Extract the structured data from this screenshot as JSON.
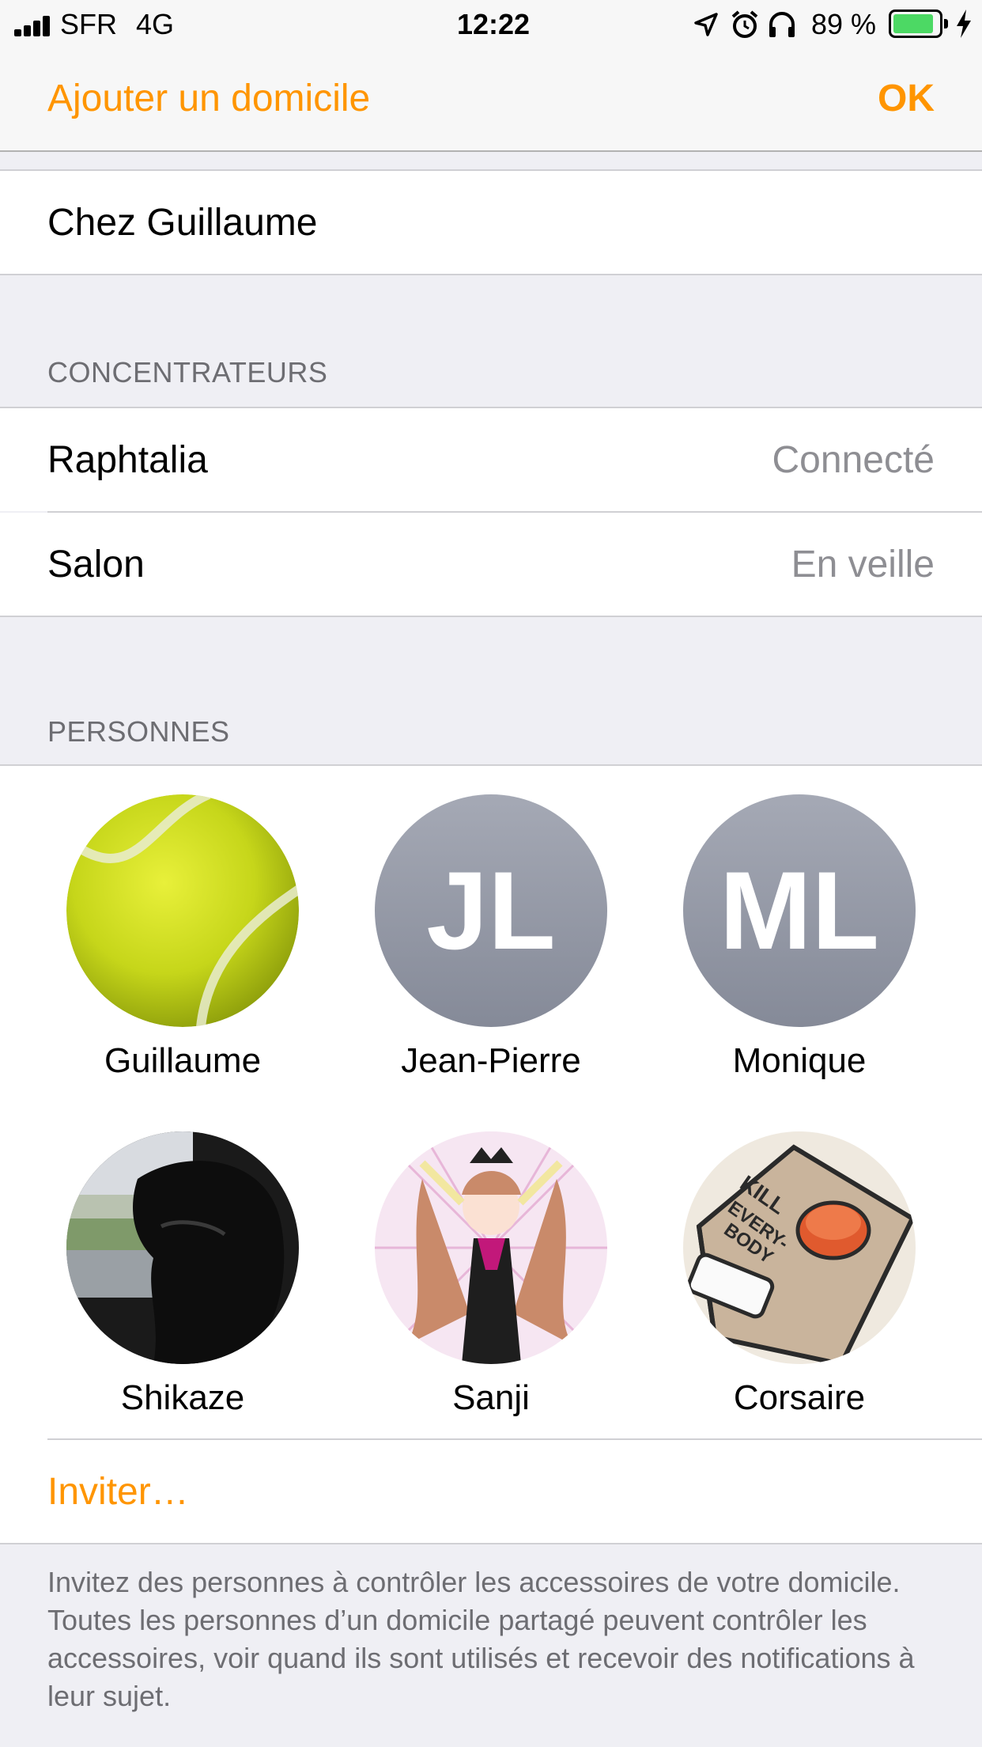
{
  "status_bar": {
    "carrier": "SFR",
    "network": "4G",
    "time": "12:22",
    "battery": "89 %",
    "battery_level": 0.89,
    "icons": [
      "location-icon",
      "alarm-icon",
      "headphones-icon",
      "battery-icon",
      "charging-icon"
    ]
  },
  "nav": {
    "title": "Ajouter un domicile",
    "done_label": "OK"
  },
  "home": {
    "name": "Chez Guillaume"
  },
  "hubs": {
    "header": "CONCENTRATEURS",
    "items": [
      {
        "name": "Raphtalia",
        "status": "Connecté"
      },
      {
        "name": "Salon",
        "status": "En veille"
      }
    ]
  },
  "people": {
    "header": "PERSONNES",
    "items": [
      {
        "name": "Guillaume",
        "avatar": "tennis-ball-photo"
      },
      {
        "name": "Jean-Pierre",
        "initials": "JL"
      },
      {
        "name": "Monique",
        "initials": "ML"
      },
      {
        "name": "Shikaze",
        "avatar": "person-in-car-photo"
      },
      {
        "name": "Sanji",
        "avatar": "anime-illustration"
      },
      {
        "name": "Corsaire",
        "avatar": "kill-everybody-button-comic"
      }
    ],
    "invite_label": "Inviter…",
    "footer": "Invitez des personnes à contrôler les accessoires de votre domicile. Toutes les personnes d’un domicile partagé peuvent contrôler les accessoires, voir quand ils sont utilisés et recevoir des notifications à leur sujet."
  },
  "colors": {
    "accent": "#ff9500",
    "background": "#efeff4",
    "secondary_text": "#8e8e93",
    "battery_fill": "#4cd964"
  }
}
